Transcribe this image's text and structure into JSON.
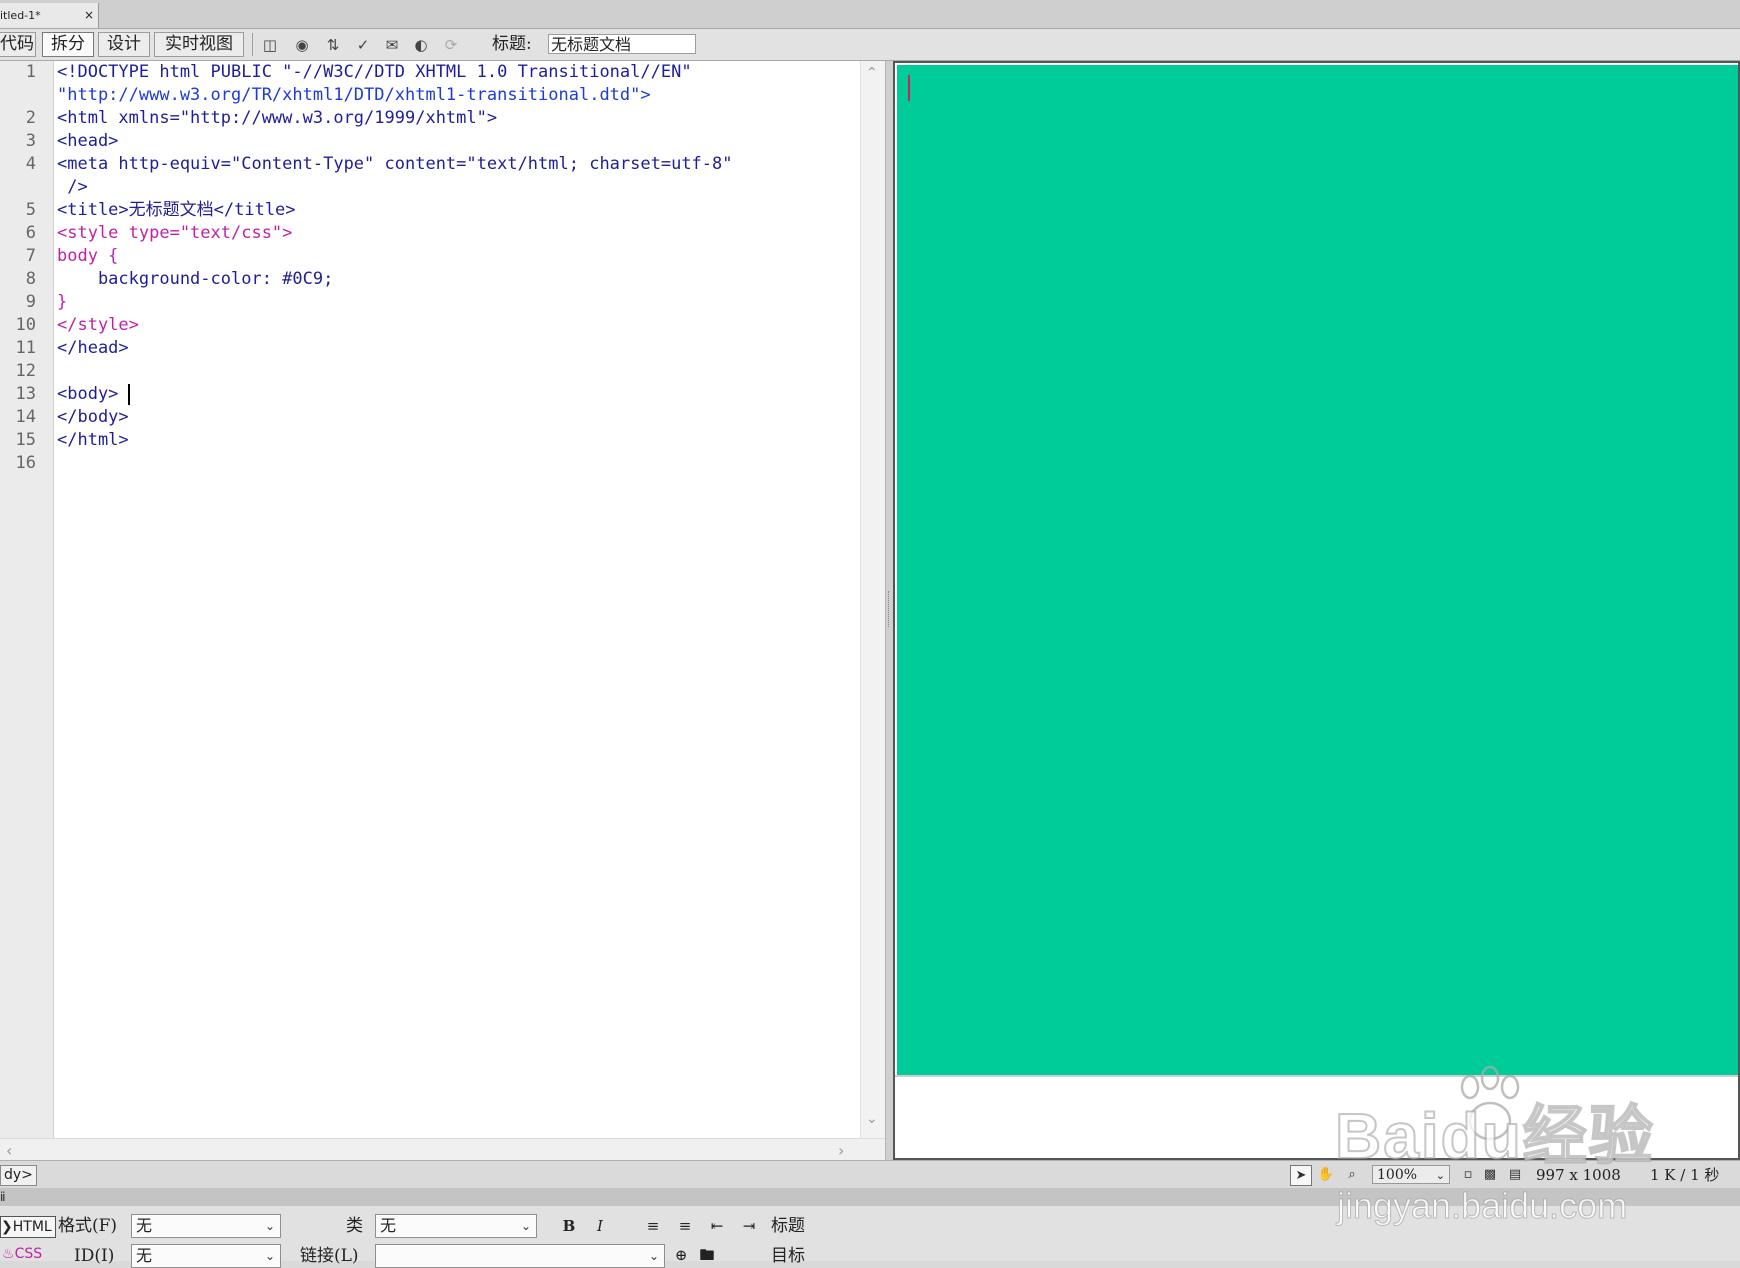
{
  "document_tab": {
    "title": "itled-1*",
    "close": "×"
  },
  "toolbar": {
    "views": [
      "代码",
      "拆分",
      "设计",
      "实时视图"
    ],
    "active_view": "拆分",
    "icons": [
      "multiscreen-icon",
      "preview-browser-icon",
      "file-management-icon",
      "w3c-validation-icon",
      "check-browser-icon",
      "visual-aids-icon",
      "refresh-icon"
    ],
    "title_label": "标题:",
    "title_value": "无标题文档"
  },
  "code": {
    "line_numbers": [
      "1",
      "2",
      "3",
      "4",
      "5",
      "6",
      "7",
      "8",
      "9",
      "10",
      "11",
      "12",
      "13",
      "14",
      "15",
      "16"
    ],
    "lines": [
      "<!DOCTYPE html PUBLIC \"-//W3C//DTD XHTML 1.0 Transitional//EN\"",
      "\"http://www.w3.org/TR/xhtml1/DTD/xhtml1-transitional.dtd\">",
      "<html xmlns=\"http://www.w3.org/1999/xhtml\">",
      "<head>",
      "<meta http-equiv=\"Content-Type\" content=\"text/html; charset=utf-8\"",
      " />",
      "<title>无标题文档</title>",
      "<style type=\"text/css\">",
      "body {",
      "    background-color: #0C9;",
      "}",
      "</style>",
      "</head>",
      "",
      "<body>",
      "</body>",
      "</html>",
      ""
    ]
  },
  "design_view": {
    "page_background": "#00cc99"
  },
  "status_bar": {
    "tag_selector": "dy>",
    "tools": [
      "select-pointer-icon",
      "hand-tool-icon",
      "zoom-tool-icon"
    ],
    "zoom": "100%",
    "window_size": "997 x 1008",
    "doc_size": "1 K / 1 秒"
  },
  "properties": {
    "header": "ⅱ",
    "tab_html": "HTML",
    "tab_css": "CSS",
    "format_label": "格式(F)",
    "format_value": "无",
    "class_label": "类",
    "class_value": "无",
    "id_label": "ID(I)",
    "id_value": "无",
    "link_label": "链接(L)",
    "link_value": "",
    "bold": "B",
    "italic": "I",
    "title_label": "标题",
    "target_label": "目标"
  },
  "watermark": {
    "logo": "Baidu经验",
    "url": "jingyan.baidu.com"
  }
}
